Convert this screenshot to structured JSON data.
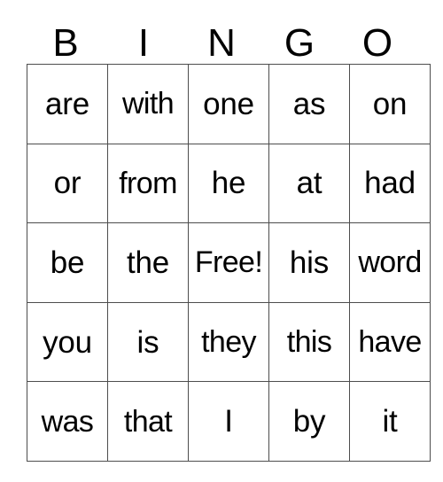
{
  "card": {
    "title": "BINGO",
    "headers": [
      "B",
      "I",
      "N",
      "G",
      "O"
    ],
    "free_space_label": "Free!",
    "free_space_position": {
      "row": 2,
      "col": 2
    },
    "colors": {
      "background": "#ffffff",
      "text": "#000000",
      "grid_line": "#4d4d4d"
    },
    "rows": [
      {
        "cells": [
          "are",
          "with",
          "one",
          "as",
          "on"
        ]
      },
      {
        "cells": [
          "or",
          "from",
          "he",
          "at",
          "had"
        ]
      },
      {
        "cells": [
          "be",
          "the",
          "Free!",
          "his",
          "word"
        ]
      },
      {
        "cells": [
          "you",
          "is",
          "they",
          "this",
          "have"
        ]
      },
      {
        "cells": [
          "was",
          "that",
          "I",
          "by",
          "it"
        ]
      }
    ]
  }
}
